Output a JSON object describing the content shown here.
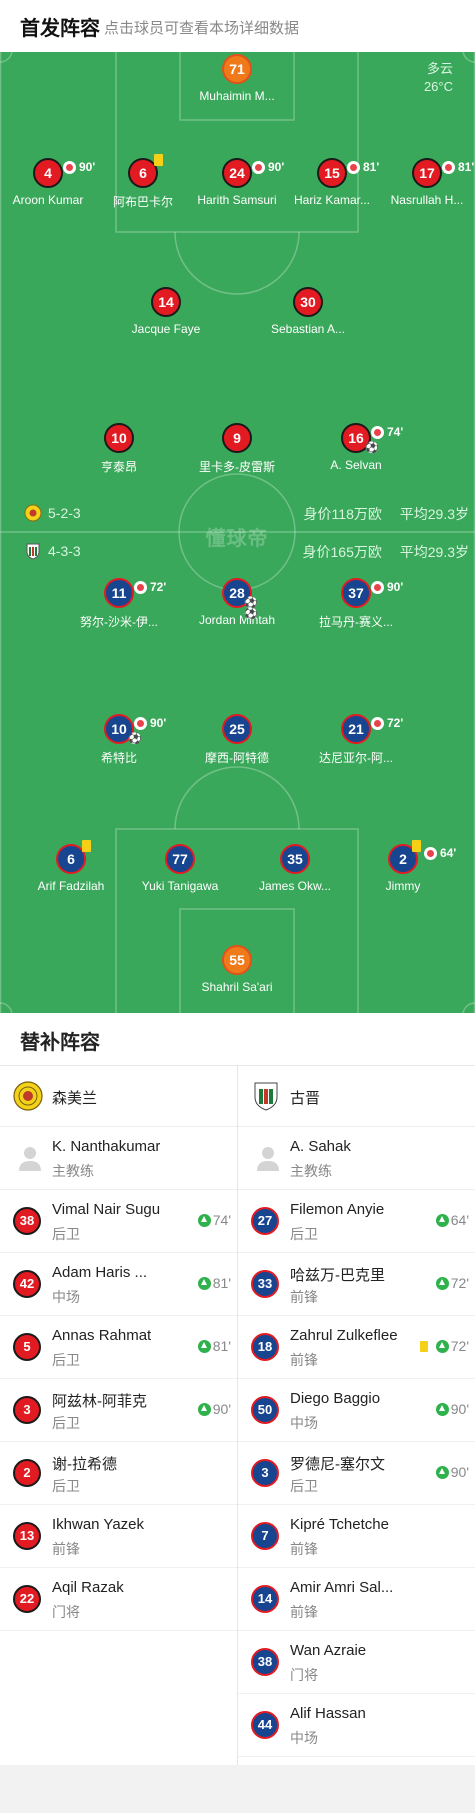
{
  "header": {
    "title": "首发阵容",
    "hint": "点击球员可查看本场详细数据"
  },
  "weather": {
    "condition": "多云",
    "temperature": "26°C"
  },
  "watermark": "懂球帝",
  "home": {
    "formation": "5-2-3",
    "value": "身价118万欧",
    "avg_age": "平均29.3岁",
    "players": [
      {
        "num": "71",
        "name": "Muhaimin M...",
        "color": "orange"
      },
      {
        "num": "4",
        "name": "Aroon Kumar",
        "sub": "90'"
      },
      {
        "num": "6",
        "name": "阿布巴卡尔",
        "yellow": true
      },
      {
        "num": "24",
        "name": "Harith Samsuri",
        "sub": "90'"
      },
      {
        "num": "15",
        "name": "Hariz Kamar...",
        "sub": "81'"
      },
      {
        "num": "17",
        "name": "Nasrullah H...",
        "sub": "81'"
      },
      {
        "num": "14",
        "name": "Jacque Faye"
      },
      {
        "num": "30",
        "name": "Sebastian A..."
      },
      {
        "num": "10",
        "name": "亨泰昂"
      },
      {
        "num": "9",
        "name": "里卡多-皮雷斯"
      },
      {
        "num": "16",
        "name": "A. Selvan",
        "sub": "74'",
        "goals": 1
      }
    ]
  },
  "away": {
    "formation": "4-3-3",
    "value": "身价165万欧",
    "avg_age": "平均29.3岁",
    "players": [
      {
        "num": "11",
        "name": "努尔-沙米-伊...",
        "sub": "72'"
      },
      {
        "num": "28",
        "name": "Jordan Mintah",
        "goals": 2
      },
      {
        "num": "37",
        "name": "拉马丹-赛义...",
        "sub": "90'"
      },
      {
        "num": "10",
        "name": "希特比",
        "sub": "90'",
        "goals": 1
      },
      {
        "num": "25",
        "name": "摩西-阿特德"
      },
      {
        "num": "21",
        "name": "达尼亚尔-阿...",
        "sub": "72'"
      },
      {
        "num": "6",
        "name": "Arif Fadzilah",
        "yellow": true
      },
      {
        "num": "77",
        "name": "Yuki Tanigawa"
      },
      {
        "num": "35",
        "name": "James Okw..."
      },
      {
        "num": "2",
        "name": "Jimmy",
        "sub": "64'",
        "yellow": true
      },
      {
        "num": "55",
        "name": "Shahril Sa'ari",
        "color": "orange"
      }
    ]
  },
  "bench": {
    "title": "替补阵容",
    "home": {
      "team": "森美兰",
      "coach": {
        "name": "K. Nanthakumar",
        "role": "主教练"
      },
      "subs": [
        {
          "num": "38",
          "name": "Vimal Nair Sugu",
          "pos": "后卫",
          "in": "74'"
        },
        {
          "num": "42",
          "name": "Adam Haris ...",
          "pos": "中场",
          "in": "81'"
        },
        {
          "num": "5",
          "name": "Annas Rahmat",
          "pos": "后卫",
          "in": "81'"
        },
        {
          "num": "3",
          "name": "阿兹林-阿菲克",
          "pos": "后卫",
          "in": "90'"
        },
        {
          "num": "2",
          "name": "谢-拉希德",
          "pos": "后卫"
        },
        {
          "num": "13",
          "name": "Ikhwan Yazek",
          "pos": "前锋"
        },
        {
          "num": "22",
          "name": "Aqil Razak",
          "pos": "门将"
        }
      ]
    },
    "away": {
      "team": "古晋",
      "coach": {
        "name": "A. Sahak",
        "role": "主教练"
      },
      "subs": [
        {
          "num": "27",
          "name": "Filemon Anyie",
          "pos": "后卫",
          "in": "64'"
        },
        {
          "num": "33",
          "name": "哈兹万-巴克里",
          "pos": "前锋",
          "in": "72'"
        },
        {
          "num": "18",
          "name": "Zahrul Zulkeflee",
          "pos": "前锋",
          "in": "72'",
          "yellow": true
        },
        {
          "num": "50",
          "name": "Diego Baggio",
          "pos": "中场",
          "in": "90'"
        },
        {
          "num": "3",
          "name": "罗德尼-塞尔文",
          "pos": "后卫",
          "in": "90'"
        },
        {
          "num": "7",
          "name": "Kipré Tchetche",
          "pos": "前锋"
        },
        {
          "num": "14",
          "name": "Amir Amri Sal...",
          "pos": "前锋"
        },
        {
          "num": "38",
          "name": "Wan Azraie",
          "pos": "门将"
        },
        {
          "num": "44",
          "name": "Alif Hassan",
          "pos": "中场"
        }
      ]
    }
  },
  "colors": {
    "pitch": "#3aa85a",
    "home_disc": "#e21b22",
    "away_disc": "#17458f",
    "keeper_disc": "#f07a1a",
    "sub_in": "#2fb24c"
  }
}
